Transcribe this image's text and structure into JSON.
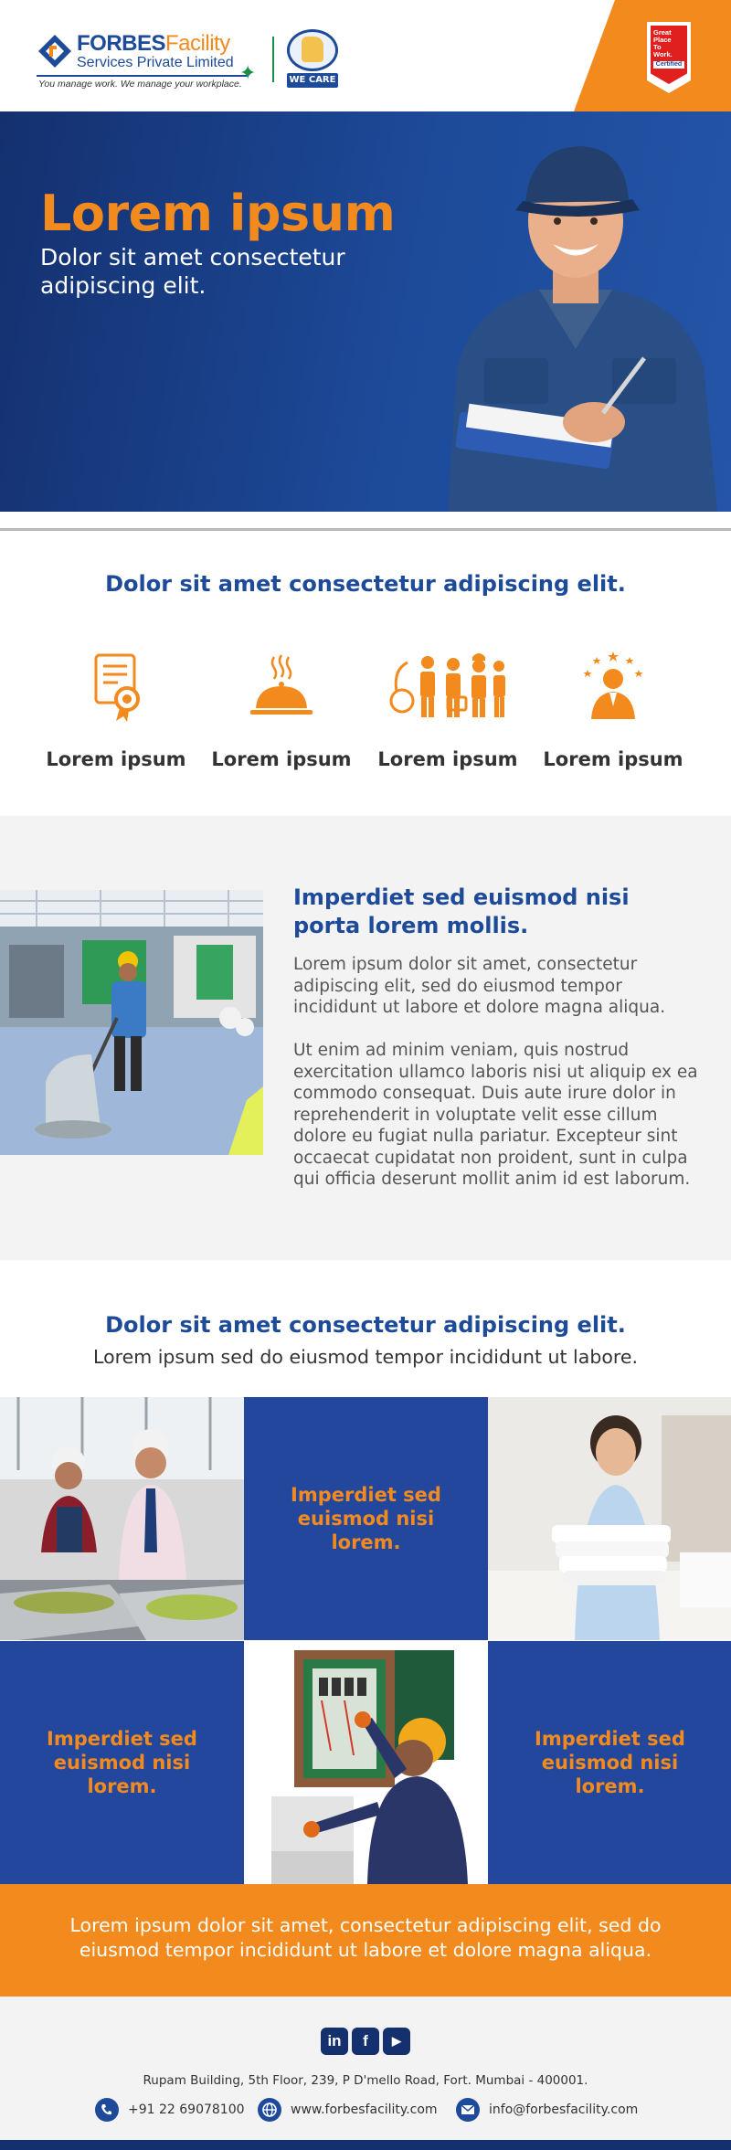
{
  "header": {
    "logo_brand": "FORBES",
    "logo_brand_suffix": "Facility",
    "logo_subtitle": "Services Private Limited",
    "logo_tagline": "You manage work. We manage your workplace.",
    "badge_label": "WE CARE",
    "certification": {
      "lines": [
        "Great",
        "Place",
        "To",
        "Work."
      ],
      "certified": "Certified"
    }
  },
  "hero": {
    "title": "Lorem ipsum",
    "subtitle": "Dolor sit amet consectetur adipiscing elit."
  },
  "features": {
    "title": "Dolor sit amet consectetur adipiscing elit.",
    "items": [
      {
        "icon": "certificate-icon",
        "label": "Lorem ipsum"
      },
      {
        "icon": "food-cloche-icon",
        "label": "Lorem ipsum"
      },
      {
        "icon": "workforce-icon",
        "label": "Lorem ipsum"
      },
      {
        "icon": "employee-star-icon",
        "label": "Lorem ipsum"
      }
    ]
  },
  "about": {
    "heading": "Imperdiet sed euismod nisi porta lorem mollis.",
    "paragraph1": "Lorem ipsum dolor sit amet, consectetur adipiscing elit, sed do eiusmod tempor incididunt ut labore et dolore magna aliqua.",
    "paragraph2": "Ut enim ad minim veniam, quis nostrud exercitation ullamco laboris nisi ut aliquip ex ea commodo consequat. Duis aute irure dolor in reprehenderit in voluptate velit esse cillum dolore eu fugiat nulla pariatur. Excepteur sint occaecat cupidatat non proident, sunt in culpa qui officia deserunt mollit anim id est laborum."
  },
  "services": {
    "title": "Dolor sit amet consectetur adipiscing elit.",
    "subtitle": "Lorem ipsum sed do eiusmod tempor incididunt ut labore.",
    "tiles": [
      "Imperdiet sed euismod nisi lorem.",
      "Imperdiet sed euismod nisi lorem.",
      "Imperdiet sed euismod nisi lorem."
    ]
  },
  "band": {
    "text": "Lorem ipsum dolor sit amet, consectetur adipiscing elit, sed do eiusmod tempor incididunt ut labore et dolore magna aliqua."
  },
  "footer": {
    "social": [
      {
        "icon": "linkedin-icon",
        "glyph": "in"
      },
      {
        "icon": "facebook-icon",
        "glyph": "f"
      },
      {
        "icon": "youtube-icon",
        "glyph": "▶"
      }
    ],
    "address": "Rupam Building, 5th Floor, 239, P D'mello Road, Fort. Mumbai - 400001.",
    "phone": "+91 22 69078100",
    "website": "www.forbesfacility.com",
    "email": "info@forbesfacility.com"
  },
  "colors": {
    "brand_blue": "#1d4a99",
    "navy": "#14306f",
    "orange": "#f28a1e",
    "green": "#1c8c4a"
  }
}
